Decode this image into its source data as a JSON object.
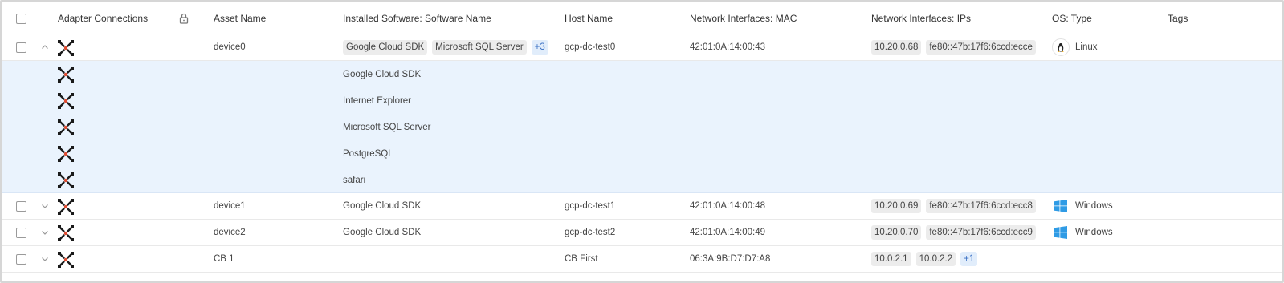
{
  "columns": {
    "adapter": "Adapter Connections",
    "asset": "Asset Name",
    "software": "Installed Software: Software Name",
    "host": "Host Name",
    "mac": "Network Interfaces: MAC",
    "ips": "Network Interfaces: IPs",
    "os": "OS: Type",
    "tags": "Tags"
  },
  "rows": [
    {
      "asset": "device0",
      "software_tags": [
        "Google Cloud SDK",
        "Microsoft SQL Server"
      ],
      "software_more": "+3",
      "host": "gcp-dc-test0",
      "mac": "42:01:0A:14:00:43",
      "ip_tags": [
        "10.20.0.68",
        "fe80::47b:17f6:6ccd:ecce"
      ],
      "os": "Linux",
      "os_icon": "linux-icon"
    },
    {
      "asset": "device1",
      "software": "Google Cloud SDK",
      "host": "gcp-dc-test1",
      "mac": "42:01:0A:14:00:48",
      "ip_tags": [
        "10.20.0.69",
        "fe80::47b:17f6:6ccd:ecc8"
      ],
      "os": "Windows",
      "os_icon": "windows-icon"
    },
    {
      "asset": "device2",
      "software": "Google Cloud SDK",
      "host": "gcp-dc-test2",
      "mac": "42:01:0A:14:00:49",
      "ip_tags": [
        "10.20.0.70",
        "fe80::47b:17f6:6ccd:ecc9"
      ],
      "os": "Windows",
      "os_icon": "windows-icon"
    },
    {
      "asset": "CB 1",
      "host": "CB First",
      "mac": "06:3A:9B:D7:D7:A8",
      "ip_tags": [
        "10.0.2.1",
        "10.0.2.2"
      ],
      "ip_more": "+1"
    }
  ],
  "expanded_software": [
    "Google Cloud SDK",
    "Internet Explorer",
    "Microsoft SQL Server",
    "PostgreSQL",
    "safari"
  ],
  "colors": {
    "expanded_bg": "#eaf3fd",
    "tag_bg": "#ececec",
    "more_fg": "#3a70c4",
    "adapter_accent": "#e04a2f"
  }
}
